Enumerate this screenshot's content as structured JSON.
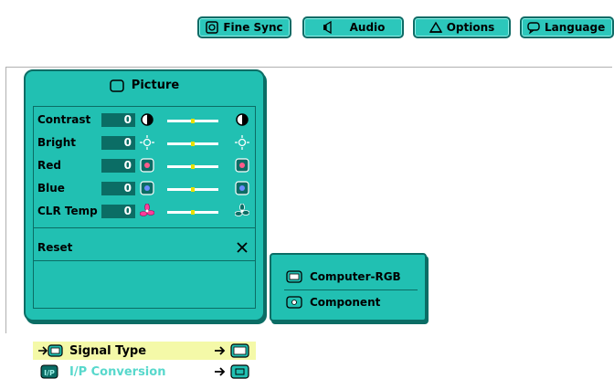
{
  "tabs": [
    {
      "label": "Fine Sync",
      "icon": "fine-sync-icon"
    },
    {
      "label": "Audio",
      "icon": "speaker-icon"
    },
    {
      "label": "Options",
      "icon": "options-icon"
    },
    {
      "label": "Language",
      "icon": "language-icon"
    }
  ],
  "panel": {
    "title": "Picture",
    "rows": [
      {
        "label": "Contrast",
        "value": "0",
        "left_icon": "contrast-icon",
        "right_icon": "contrast-icon"
      },
      {
        "label": "Bright",
        "value": "0",
        "left_icon": "brightness-icon",
        "right_icon": "brightness-icon"
      },
      {
        "label": "Red",
        "value": "0",
        "left_icon": "red-icon",
        "right_icon": "red-icon"
      },
      {
        "label": "Blue",
        "value": "0",
        "left_icon": "blue-icon",
        "right_icon": "blue-icon"
      },
      {
        "label": "CLR Temp",
        "value": "0",
        "left_icon": "fan-icon",
        "right_icon": "fan-icon"
      }
    ],
    "reset": "Reset",
    "reset_icon": "close-icon",
    "signal_type": "Signal Type",
    "ip_conversion": "I/P Conversion"
  },
  "submenu": {
    "items": [
      "Computer-RGB",
      "Component"
    ]
  },
  "colors": {
    "accent": "#21c0b2",
    "dark": "#0b6d65",
    "highlight": "#f4f9a8",
    "slider_mark": "#e7e100"
  }
}
